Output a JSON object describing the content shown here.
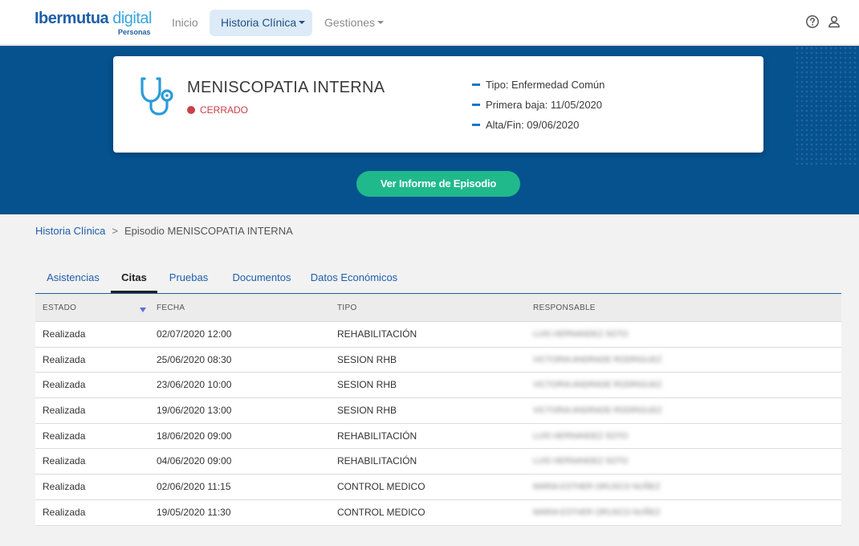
{
  "brand": {
    "logo_part1": "Ibermutua",
    "logo_part2": " digital",
    "logo_sub": "Personas"
  },
  "nav": {
    "inicio": "Inicio",
    "historia": "Historia Clínica",
    "gestiones": "Gestiones",
    "help_icon": "help-circle-icon",
    "user_icon": "user-icon"
  },
  "episode": {
    "icon": "stethoscope-icon",
    "title": "MENISCOPATIA INTERNA",
    "status": "CERRADO",
    "status_color": "#c9414a",
    "details": [
      "Tipo: Enfermedad Común",
      "Primera baja: 11/05/2020",
      "Alta/Fin: 09/06/2020"
    ],
    "report_button": "Ver Informe de Episodio"
  },
  "breadcrumb": {
    "root": "Historia Clínica",
    "separator": ">",
    "current": "Episodio MENISCOPATIA INTERNA"
  },
  "tabs": [
    {
      "label": "Asistencias",
      "active": false
    },
    {
      "label": "Citas",
      "active": true
    },
    {
      "label": "Pruebas",
      "active": false
    },
    {
      "label": "Documentos",
      "active": false
    },
    {
      "label": "Datos Económicos",
      "active": false
    }
  ],
  "table": {
    "columns": [
      "ESTADO",
      "FECHA",
      "TIPO",
      "RESPONSABLE"
    ],
    "sort_icon": "sort-down-icon",
    "rows": [
      {
        "estado": "Realizada",
        "fecha": "02/07/2020 12:00",
        "tipo": "REHABILITACIÓN",
        "responsable": "LUIS HERNANDEZ SOTO"
      },
      {
        "estado": "Realizada",
        "fecha": "25/06/2020 08:30",
        "tipo": "SESION RHB",
        "responsable": "VICTORIA ANDRADE RODRIGUEZ"
      },
      {
        "estado": "Realizada",
        "fecha": "23/06/2020 10:00",
        "tipo": "SESION RHB",
        "responsable": "VICTORIA ANDRADE RODRIGUEZ"
      },
      {
        "estado": "Realizada",
        "fecha": "19/06/2020 13:00",
        "tipo": "SESION RHB",
        "responsable": "VICTORIA ANDRADE RODRIGUEZ"
      },
      {
        "estado": "Realizada",
        "fecha": "18/06/2020 09:00",
        "tipo": "REHABILITACIÓN",
        "responsable": "LUIS HERNANDEZ SOTO"
      },
      {
        "estado": "Realizada",
        "fecha": "04/06/2020 09:00",
        "tipo": "REHABILITACIÓN",
        "responsable": "LUIS HERNANDEZ SOTO"
      },
      {
        "estado": "Realizada",
        "fecha": "02/06/2020 11:15",
        "tipo": "CONTROL MEDICO",
        "responsable": "MARIA ESTHER ORUSCO NUÑEZ"
      },
      {
        "estado": "Realizada",
        "fecha": "19/05/2020 11:30",
        "tipo": "CONTROL MEDICO",
        "responsable": "MARIA ESTHER ORUSCO NUÑEZ"
      }
    ]
  },
  "colors": {
    "primary_blue": "#05528f",
    "link_blue": "#1f5fa8",
    "button_green": "#20b98b",
    "status_red": "#c9414a"
  }
}
